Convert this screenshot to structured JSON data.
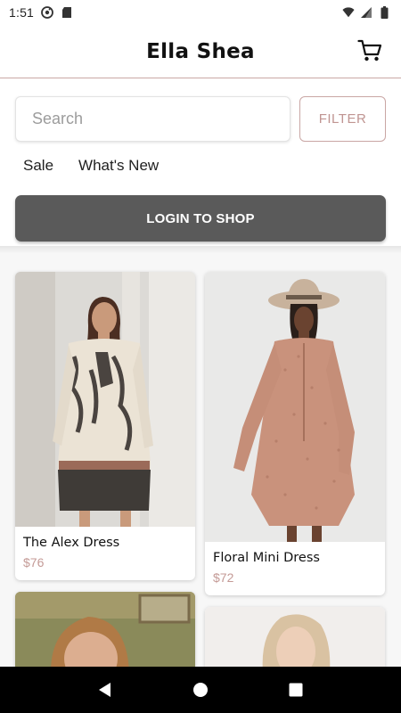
{
  "status_bar": {
    "time": "1:51",
    "icons": [
      "at-sign-icon",
      "sd-card-icon",
      "wifi-icon",
      "signal-icon",
      "battery-icon"
    ]
  },
  "header": {
    "title": "Ella Shea",
    "cart_icon": "cart-icon"
  },
  "search": {
    "placeholder": "Search",
    "value": "",
    "filter_label": "FILTER"
  },
  "categories": [
    "Sale",
    "What's New"
  ],
  "login_button": "LOGIN TO SHOP",
  "products": [
    {
      "name": "The Alex Dress",
      "price": "$76"
    },
    {
      "name": "Floral Mini Dress",
      "price": "$72"
    },
    {
      "name": "",
      "price": ""
    },
    {
      "name": "",
      "price": ""
    }
  ],
  "nav": [
    "back-icon",
    "home-icon",
    "recents-icon"
  ],
  "colors": {
    "accent": "#c49a96",
    "login_bg": "#5a5a5a",
    "header_border": "#caa8a5"
  }
}
